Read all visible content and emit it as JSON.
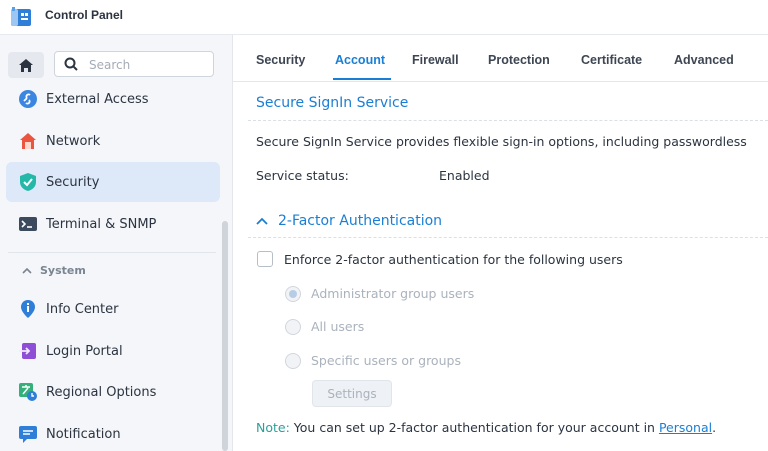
{
  "window": {
    "title": "Control Panel"
  },
  "colors": {
    "accent": "#1a7fd4",
    "note": "#2aa198",
    "active_bg": "#dde9f8"
  },
  "sidebar": {
    "search_placeholder": "Search",
    "items": [
      {
        "label": "External Access",
        "icon": "external-access-icon"
      },
      {
        "label": "Network",
        "icon": "network-house-icon"
      },
      {
        "label": "Security",
        "icon": "shield-check-icon",
        "active": true
      },
      {
        "label": "Terminal & SNMP",
        "icon": "terminal-icon"
      }
    ],
    "group_label": "System",
    "system_items": [
      {
        "label": "Info Center",
        "icon": "info-icon"
      },
      {
        "label": "Login Portal",
        "icon": "login-portal-icon"
      },
      {
        "label": "Regional Options",
        "icon": "regional-options-icon"
      },
      {
        "label": "Notification",
        "icon": "notification-icon"
      }
    ]
  },
  "tabs": [
    {
      "label": "Security"
    },
    {
      "label": "Account",
      "active": true
    },
    {
      "label": "Firewall"
    },
    {
      "label": "Protection"
    },
    {
      "label": "Certificate"
    },
    {
      "label": "Advanced"
    }
  ],
  "signin": {
    "title": "Secure SignIn Service",
    "description": "Secure SignIn Service provides flexible sign-in options, including passwordless",
    "status_label": "Service status:",
    "status_value": "Enabled"
  },
  "twofa": {
    "title": "2-Factor Authentication",
    "enforce_label": "Enforce 2-factor authentication for the following users",
    "options": [
      {
        "label": "Administrator group users",
        "selected": true
      },
      {
        "label": "All users",
        "selected": false
      },
      {
        "label": "Specific users or groups",
        "selected": false
      }
    ],
    "settings_button": "Settings"
  },
  "note": {
    "label": "Note:",
    "text": "You can set up 2-factor authentication for your account in",
    "link": "Personal",
    "end": "."
  }
}
